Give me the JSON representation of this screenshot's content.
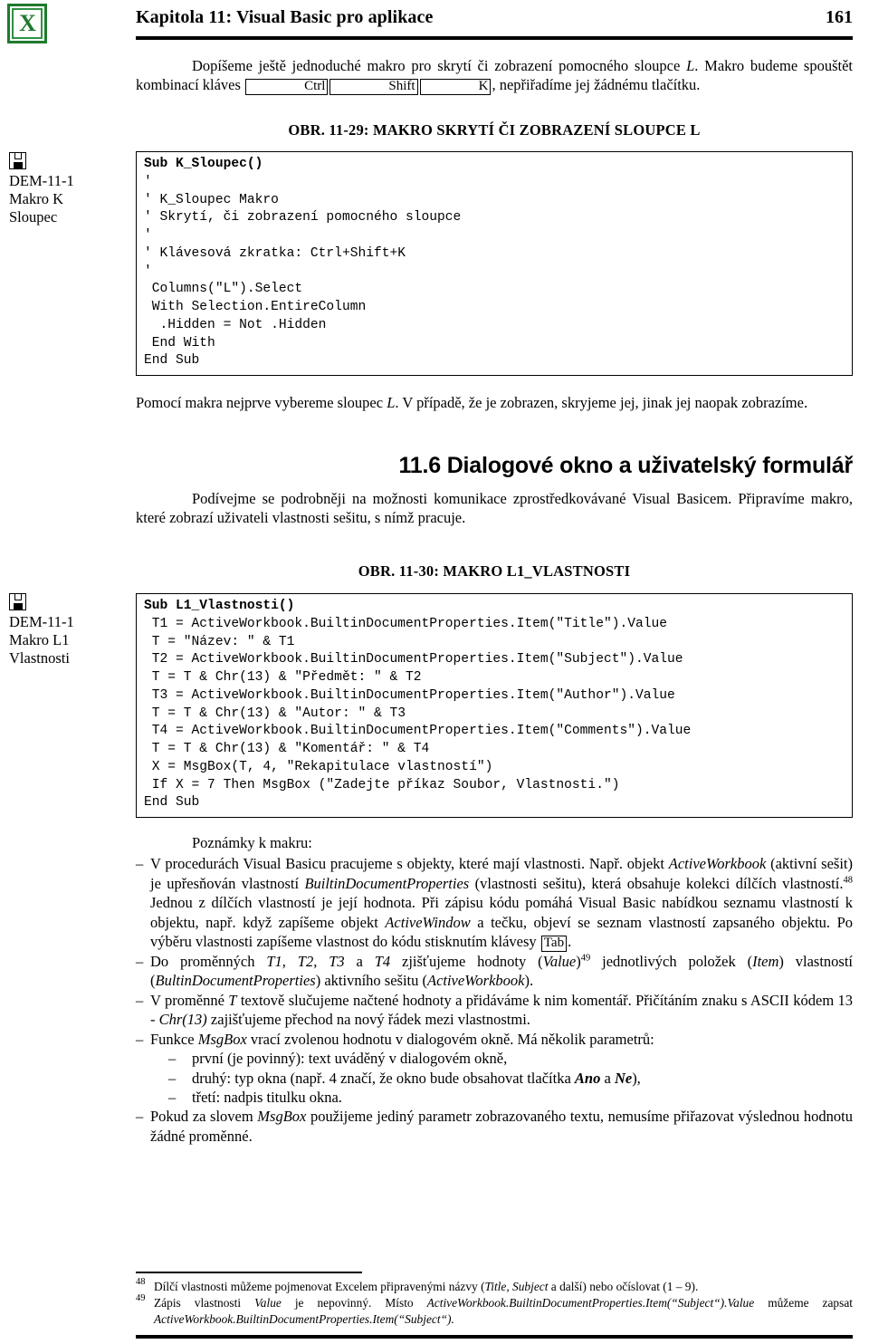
{
  "header": {
    "logo_alt": "Excel logo",
    "title": "Kapitola 11: Visual Basic pro aplikace",
    "page_number": "161"
  },
  "intro": {
    "line1_a": "Dopíšeme ještě jednoduché makro pro skrytí či zobrazení pomocného sloupce ",
    "line1_italic": "L",
    "line1_b": ".",
    "line2_a": "Makro budeme spouštět kombinací kláves ",
    "keys": [
      "Ctrl",
      "Shift",
      "K"
    ],
    "line2_b": ", nepřiřadíme jej žádnému tlačítku."
  },
  "figure1": {
    "caption": "OBR. 11-29: MAKRO SKRYTÍ ČI ZOBRAZENÍ SLOUPCE L",
    "margin_note": {
      "icon": "floppy-disk-icon",
      "lines": [
        "DEM-11-1",
        "Makro K",
        "Sloupec"
      ]
    },
    "code_signature": "Sub K_Sloupec()",
    "code_body": "'\n' K_Sloupec Makro\n' Skrytí, či zobrazení pomocného sloupce\n'\n' Klávesová zkratka: Ctrl+Shift+K\n'\n Columns(\"L\").Select\n With Selection.EntireColumn\n  .Hidden = Not .Hidden\n End With\nEnd Sub"
  },
  "para_after_fig1": {
    "a": "Pomocí makra nejprve vybereme sloupec ",
    "italic": "L",
    "b": ". V případě, že je zobrazen, skryjeme jej, jinak jej naopak zobrazíme."
  },
  "section": {
    "heading": "11.6 Dialogové okno a uživatelský formulář",
    "para": "Podívejme se podrobněji na možnosti komunikace zprostředkovávané Visual Basicem. Připravíme makro, které zobrazí uživateli vlastnosti sešitu, s nímž pracuje."
  },
  "figure2": {
    "caption": "OBR. 11-30: MAKRO L1_VLASTNOSTI",
    "margin_note": {
      "icon": "floppy-disk-icon",
      "lines": [
        "DEM-11-1",
        "Makro L1",
        "Vlastnosti"
      ]
    },
    "code_signature": "Sub L1_Vlastnosti()",
    "code_body": " T1 = ActiveWorkbook.BuiltinDocumentProperties.Item(\"Title\").Value\n T = \"Název: \" & T1\n T2 = ActiveWorkbook.BuiltinDocumentProperties.Item(\"Subject\").Value\n T = T & Chr(13) & \"Předmět: \" & T2\n T3 = ActiveWorkbook.BuiltinDocumentProperties.Item(\"Author\").Value\n T = T & Chr(13) & \"Autor: \" & T3\n T4 = ActiveWorkbook.BuiltinDocumentProperties.Item(\"Comments\").Value\n T = T & Chr(13) & \"Komentář: \" & T4\n X = MsgBox(T, 4, \"Rekapitulace vlastností\")\n If X = 7 Then MsgBox (\"Zadejte příkaz Soubor, Vlastnosti.\")\nEnd Sub"
  },
  "notes": {
    "title": "Poznámky k makru:",
    "dash": "–",
    "items": [
      {
        "id": "note-objects",
        "parts": [
          {
            "t": "V procedurách Visual Basicu pracujeme s objekty, které mají vlastnosti. Např. objekt "
          },
          {
            "t": "ActiveWorkbook",
            "style": "italic"
          },
          {
            "t": " (aktivní sešit) je upřesňován vlastností "
          },
          {
            "t": "BuiltinDocumentProperties",
            "style": "italic"
          },
          {
            "t": " (vlastnosti sešitu), která obsahuje kolekci dílčích vlastností."
          },
          {
            "t": "48",
            "style": "sup"
          },
          {
            "t": " Jednou z dílčích vlastností je její hodnota. Při zápisu kódu pomáhá Visual Basic nabídkou seznamu vlastností k objektu, např. když zapíšeme objekt "
          },
          {
            "t": "ActiveWindow",
            "style": "italic"
          },
          {
            "t": " a tečku, objeví se seznam vlastností zapsaného objektu. Po výběru vlastnosti zapíšeme vlastnost do kódu stisknutím klávesy "
          },
          {
            "t": "Tab",
            "style": "key"
          },
          {
            "t": "."
          }
        ]
      },
      {
        "id": "note-variables",
        "parts": [
          {
            "t": "Do proměnných "
          },
          {
            "t": "T1, T2, T3",
            "style": "italic"
          },
          {
            "t": " a "
          },
          {
            "t": "T4",
            "style": "italic"
          },
          {
            "t": " zjišťujeme hodnoty ("
          },
          {
            "t": "Value",
            "style": "italic"
          },
          {
            "t": ")"
          },
          {
            "t": "49",
            "style": "sup"
          },
          {
            "t": " jednotlivých položek ("
          },
          {
            "t": "Item",
            "style": "italic"
          },
          {
            "t": ") vlastností ("
          },
          {
            "t": "BultinDocumentProperties",
            "style": "italic"
          },
          {
            "t": ") aktivního sešitu ("
          },
          {
            "t": "ActiveWorkbook",
            "style": "italic"
          },
          {
            "t": ")."
          }
        ]
      },
      {
        "id": "note-concat",
        "parts": [
          {
            "t": "V proměnné "
          },
          {
            "t": "T",
            "style": "italic"
          },
          {
            "t": " textově slučujeme načtené hodnoty a přidáváme k nim komentář. Přičítáním znaku s ASCII kódem 13 - "
          },
          {
            "t": "Chr(13)",
            "style": "italic"
          },
          {
            "t": " zajišťujeme přechod na nový řádek mezi vlastnostmi."
          }
        ]
      },
      {
        "id": "note-msgbox",
        "parts": [
          {
            "t": "Funkce "
          },
          {
            "t": "MsgBox",
            "style": "italic"
          },
          {
            "t": " vrací zvolenou hodnotu v dialogovém okně. Má několik parametrů:"
          }
        ]
      }
    ],
    "subitems": [
      {
        "id": "note-param-first",
        "parts": [
          {
            "t": "první (je povinný): text uváděný v dialogovém okně,"
          }
        ]
      },
      {
        "id": "note-param-second",
        "parts": [
          {
            "t": "druhý: typ okna (např. 4 značí, že okno bude obsahovat tlačítka "
          },
          {
            "t": "Ano",
            "style": "bolditalic"
          },
          {
            "t": " a "
          },
          {
            "t": "Ne",
            "style": "bolditalic"
          },
          {
            "t": "),"
          }
        ]
      },
      {
        "id": "note-param-third",
        "parts": [
          {
            "t": "třetí: nadpis titulku okna."
          }
        ]
      }
    ],
    "last_item": {
      "id": "note-single-param",
      "parts": [
        {
          "t": "Pokud za slovem "
        },
        {
          "t": "MsgBox",
          "style": "italic"
        },
        {
          "t": " použijeme jediný parametr zobrazovaného textu, nemusíme přiřazovat výslednou hodnotu žádné proměnné."
        }
      ]
    }
  },
  "footnotes": [
    {
      "num": "48",
      "parts": [
        {
          "t": "Dílčí vlastnosti můžeme pojmenovat Excelem připravenými názvy ("
        },
        {
          "t": "Title, Subject",
          "style": "italic"
        },
        {
          "t": " a další) nebo očíslovat (1 – 9)."
        }
      ]
    },
    {
      "num": "49",
      "parts": [
        {
          "t": "Zápis vlastnosti "
        },
        {
          "t": "Value",
          "style": "italic"
        },
        {
          "t": " je nepovinný.  Místo "
        },
        {
          "t": "ActiveWorkbook.BuiltinDocumentProperties.Item(“Subject“).Value",
          "style": "italic"
        },
        {
          "t": " můžeme zapsat "
        },
        {
          "t": "ActiveWorkbook.BuiltinDocumentProperties.Item(“Subject“).",
          "style": "italic"
        }
      ]
    }
  ]
}
